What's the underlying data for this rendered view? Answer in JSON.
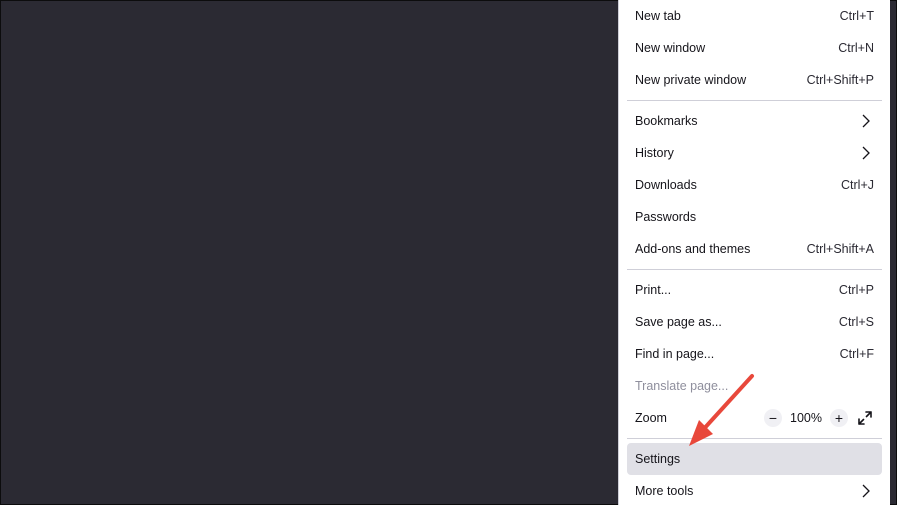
{
  "menu": {
    "items": [
      {
        "label": "New tab",
        "shortcut": "Ctrl+T"
      },
      {
        "label": "New window",
        "shortcut": "Ctrl+N"
      },
      {
        "label": "New private window",
        "shortcut": "Ctrl+Shift+P"
      },
      {
        "label": "Bookmarks"
      },
      {
        "label": "History"
      },
      {
        "label": "Downloads",
        "shortcut": "Ctrl+J"
      },
      {
        "label": "Passwords"
      },
      {
        "label": "Add-ons and themes",
        "shortcut": "Ctrl+Shift+A"
      },
      {
        "label": "Print...",
        "shortcut": "Ctrl+P"
      },
      {
        "label": "Save page as...",
        "shortcut": "Ctrl+S"
      },
      {
        "label": "Find in page...",
        "shortcut": "Ctrl+F"
      },
      {
        "label": "Translate page..."
      },
      {
        "label": "Zoom"
      },
      {
        "label": "Settings"
      },
      {
        "label": "More tools"
      }
    ],
    "zoom": {
      "minus": "−",
      "value": "100%",
      "plus": "+"
    }
  },
  "icons": {
    "submenu": "chevron-right-icon",
    "fullscreen": "fullscreen-icon"
  },
  "colors": {
    "background": "#2b2a33",
    "menu_bg": "#ffffff",
    "highlight": "#e0e0e6",
    "disabled_text": "#8f8f9d",
    "annotation_arrow": "#e8483b"
  }
}
